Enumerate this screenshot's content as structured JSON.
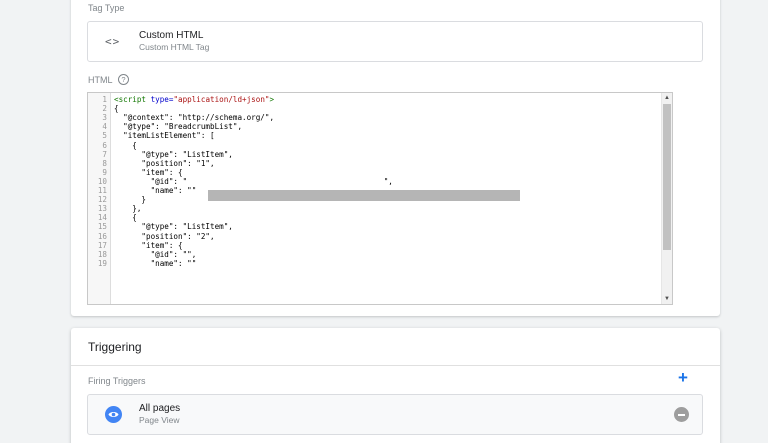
{
  "tag_config": {
    "tag_type_label": "Tag Type",
    "tag_type": {
      "title": "Custom HTML",
      "subtitle": "Custom HTML Tag",
      "icon": "code-brackets-icon"
    },
    "html_label": "HTML",
    "help_glyph": "?",
    "editor_lines": [
      {
        "n": "1",
        "text": "<script type=\"application/ld+json\">"
      },
      {
        "n": "2",
        "text": "{"
      },
      {
        "n": "3",
        "text": "  \"@context\": \"http://schema.org/\","
      },
      {
        "n": "4",
        "text": "  \"@type\": \"BreadcrumbList\","
      },
      {
        "n": "5",
        "text": "  \"itemListElement\": ["
      },
      {
        "n": "6",
        "text": "    {"
      },
      {
        "n": "7",
        "text": "      \"@type\": \"ListItem\","
      },
      {
        "n": "8",
        "text": "      \"position\": \"1\","
      },
      {
        "n": "9",
        "text": "      \"item\": {"
      },
      {
        "n": "10",
        "text": "        \"@id\": \"                                           \","
      },
      {
        "n": "11",
        "text": "        \"name\": \"\""
      },
      {
        "n": "12",
        "text": "      }"
      },
      {
        "n": "13",
        "text": "    },"
      },
      {
        "n": "14",
        "text": "    {"
      },
      {
        "n": "15",
        "text": "      \"@type\": \"ListItem\","
      },
      {
        "n": "16",
        "text": "      \"position\": \"2\","
      },
      {
        "n": "17",
        "text": "      \"item\": {"
      },
      {
        "n": "18",
        "text": "        \"@id\": \"\","
      },
      {
        "n": "19",
        "text": "        \"name\": \"\""
      }
    ]
  },
  "triggering": {
    "title": "Triggering",
    "firing_label": "Firing Triggers",
    "add_glyph": "+",
    "triggers": [
      {
        "name": "All pages",
        "type": "Page View",
        "icon": "eye-icon",
        "color": "#4285f4"
      }
    ]
  },
  "colors": {
    "accent": "#1a73e8",
    "code_tag": "#117700",
    "code_attr": "#0000cc",
    "code_string": "#aa1111"
  }
}
